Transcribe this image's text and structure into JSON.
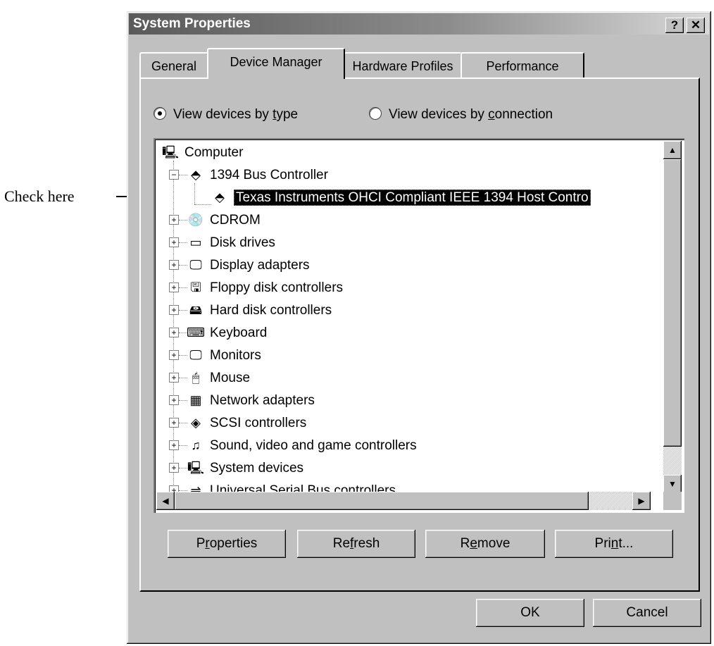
{
  "annotation": {
    "label": "Check here"
  },
  "window": {
    "title": "System Properties",
    "help_label": "?",
    "close_label": "✕"
  },
  "tabs": [
    {
      "label": "General"
    },
    {
      "label": "Device Manager",
      "active": true
    },
    {
      "label": "Hardware Profiles"
    },
    {
      "label": "Performance"
    }
  ],
  "view_options": {
    "by_type": {
      "pre": "View devices by ",
      "u": "t",
      "post": "ype",
      "selected": true
    },
    "by_connection": {
      "pre": "View devices by ",
      "u": "c",
      "post": "onnection",
      "selected": false
    }
  },
  "tree": {
    "root": {
      "label": "Computer",
      "icon": "computer-icon"
    },
    "expanded_category": {
      "label": "1394 Bus Controller",
      "icon": "controller-icon",
      "expander": "−"
    },
    "selected_child": {
      "label": "Texas Instruments OHCI Compliant IEEE 1394 Host Contro",
      "icon": "controller-icon"
    },
    "categories": [
      {
        "label": "CDROM",
        "icon": "cdrom-icon"
      },
      {
        "label": "Disk drives",
        "icon": "disk-drive-icon"
      },
      {
        "label": "Display adapters",
        "icon": "monitor-icon"
      },
      {
        "label": "Floppy disk controllers",
        "icon": "floppy-controller-icon"
      },
      {
        "label": "Hard disk controllers",
        "icon": "hard-disk-controller-icon"
      },
      {
        "label": "Keyboard",
        "icon": "keyboard-icon"
      },
      {
        "label": "Monitors",
        "icon": "monitor-icon"
      },
      {
        "label": "Mouse",
        "icon": "mouse-icon"
      },
      {
        "label": "Network adapters",
        "icon": "network-adapter-icon"
      },
      {
        "label": "SCSI controllers",
        "icon": "scsi-icon"
      },
      {
        "label": "Sound, video and game controllers",
        "icon": "sound-icon"
      },
      {
        "label": "System devices",
        "icon": "system-device-icon"
      },
      {
        "label": "Universal Serial Bus controllers",
        "icon": "usb-icon"
      }
    ],
    "collapsed_expander": "+"
  },
  "buttons": {
    "properties": {
      "pre": "P",
      "u": "r",
      "post": "operties"
    },
    "refresh": {
      "pre": "Re",
      "u": "f",
      "post": "resh"
    },
    "remove": {
      "pre": "R",
      "u": "e",
      "post": "move"
    },
    "print": {
      "pre": "Pri",
      "u": "n",
      "post": "t..."
    },
    "ok": "OK",
    "cancel": "Cancel"
  },
  "colors": {
    "title_start": "#5a5a5a",
    "title_end": "#d8d8d8",
    "face": "#c0c0c0",
    "selection": "#000000"
  }
}
